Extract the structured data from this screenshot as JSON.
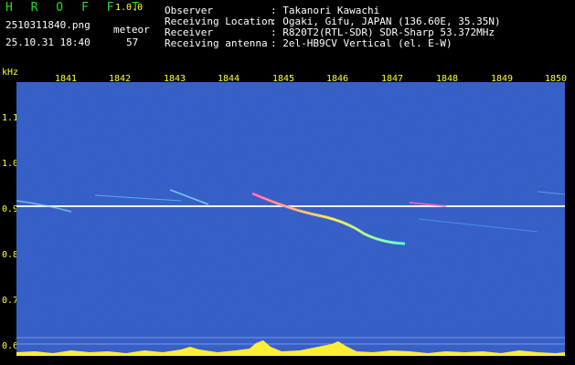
{
  "app": {
    "name": "H R O F F T",
    "version": "1.0.0"
  },
  "file": {
    "name": "2510311840.png",
    "datetime": "25.10.31 18:40"
  },
  "meteor": {
    "label": "meteor",
    "count": "57"
  },
  "info": [
    {
      "key": "Observer",
      "value": ": Takanori Kawachi"
    },
    {
      "key": "Receiving Location",
      "value": ": Ogaki, Gifu, JAPAN (136.60E, 35.35N)"
    },
    {
      "key": "Receiver",
      "value": ": R820T2(RTL-SDR) SDR-Sharp 53.372MHz"
    },
    {
      "key": "Receiving antenna",
      "value": ": 2el-HB9CV Vertical (el. E-W)"
    }
  ],
  "axis": {
    "y_unit": "kHz",
    "x_ticks": [
      "1841",
      "1842",
      "1843",
      "1844",
      "1845",
      "1846",
      "1847",
      "1848",
      "1849",
      "1850"
    ],
    "y_ticks": [
      "1.1",
      "1.0",
      "0.9",
      "0.8",
      "0.7",
      "0.6"
    ]
  },
  "colors": {
    "background": "#0a1a8a",
    "tick_label": "#ffff33",
    "title": "#22dd22",
    "carrier": "#ffffff"
  }
}
